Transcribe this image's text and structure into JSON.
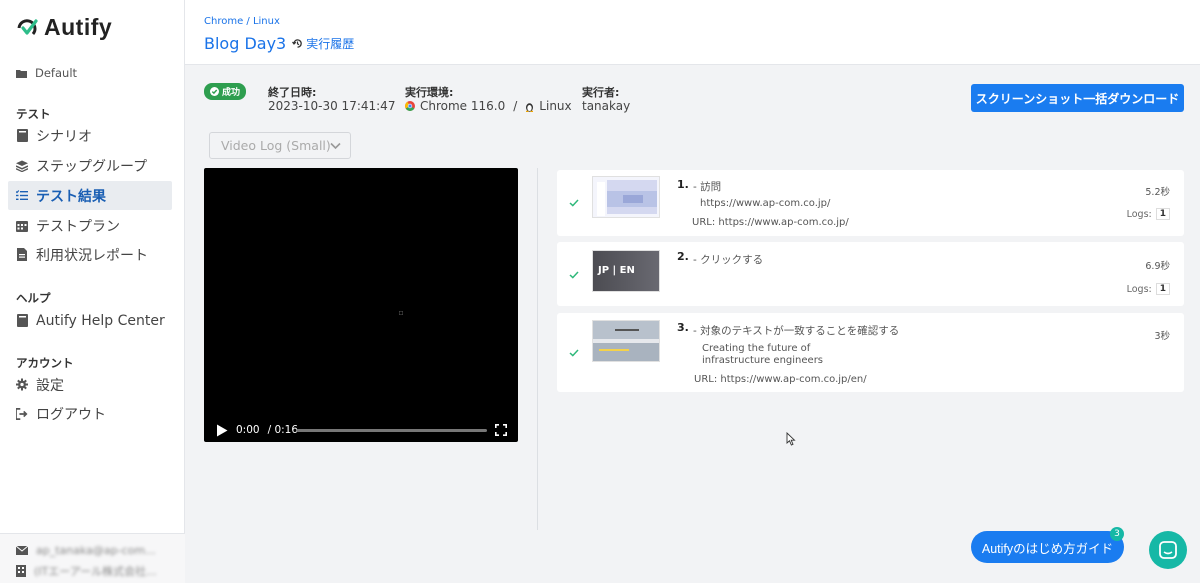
{
  "sidebar": {
    "logo": "Autify",
    "workspace": "Default",
    "sections": {
      "test": "テスト",
      "help": "ヘルプ",
      "account": "アカウント"
    },
    "items": [
      {
        "label": "シナリオ",
        "icon": "book-icon"
      },
      {
        "label": "ステップグループ",
        "icon": "layers-icon"
      },
      {
        "label": "テスト結果",
        "icon": "list-check-icon"
      },
      {
        "label": "テストプラン",
        "icon": "calendar-icon"
      },
      {
        "label": "利用状況レポート",
        "icon": "document-icon"
      },
      {
        "label": "Autify Help Center",
        "icon": "book-icon"
      },
      {
        "label": "設定",
        "icon": "gear-icon"
      },
      {
        "label": "ログアウト",
        "icon": "sign-out-icon"
      }
    ],
    "footer": {
      "email": "ap_tanaka@ap-com...",
      "org": "(ITエーアール株式会社..."
    }
  },
  "header": {
    "breadcrumb": "Chrome / Linux",
    "title": "Blog Day3",
    "history_label": "実行履歴"
  },
  "summary": {
    "status_badge": "成功",
    "end_time_label": "終了日時:",
    "end_time_value": "2023-10-30 17:41:47",
    "env_label": "実行環境:",
    "env_browser": "Chrome 116.0",
    "env_sep": "/",
    "env_os": "Linux",
    "executor_label": "実行者:",
    "executor_value": "tanakay",
    "download_button": "スクリーンショット一括ダウンロード"
  },
  "video": {
    "select_value": "Video Log (Small)",
    "current_time": "0:00",
    "duration": "/ 0:16"
  },
  "steps": [
    {
      "num": "1.",
      "title": "- 訪問",
      "sub": "https://www.ap-com.co.jp/",
      "url": "URL: https://www.ap-com.co.jp/",
      "time": "5.2秒",
      "logs_label": "Logs:",
      "logs_count": "1"
    },
    {
      "num": "2.",
      "title": "- クリックする",
      "time": "6.9秒",
      "logs_label": "Logs:",
      "logs_count": "1",
      "thumb_text": "JP | EN"
    },
    {
      "num": "3.",
      "title": "- 対象のテキストが一致することを確認する",
      "sub_line1": "Creating the future of",
      "sub_line2": "infrastructure engineers",
      "url": "URL: https://www.ap-com.co.jp/en/",
      "time": "3秒"
    }
  ],
  "guide": {
    "label": "Autifyのはじめ方ガイド",
    "badge": "3"
  },
  "colors": {
    "accent": "#1a7cf0",
    "link": "#1a73e8",
    "success": "#2e9e4f",
    "teal": "#16b8a6"
  }
}
